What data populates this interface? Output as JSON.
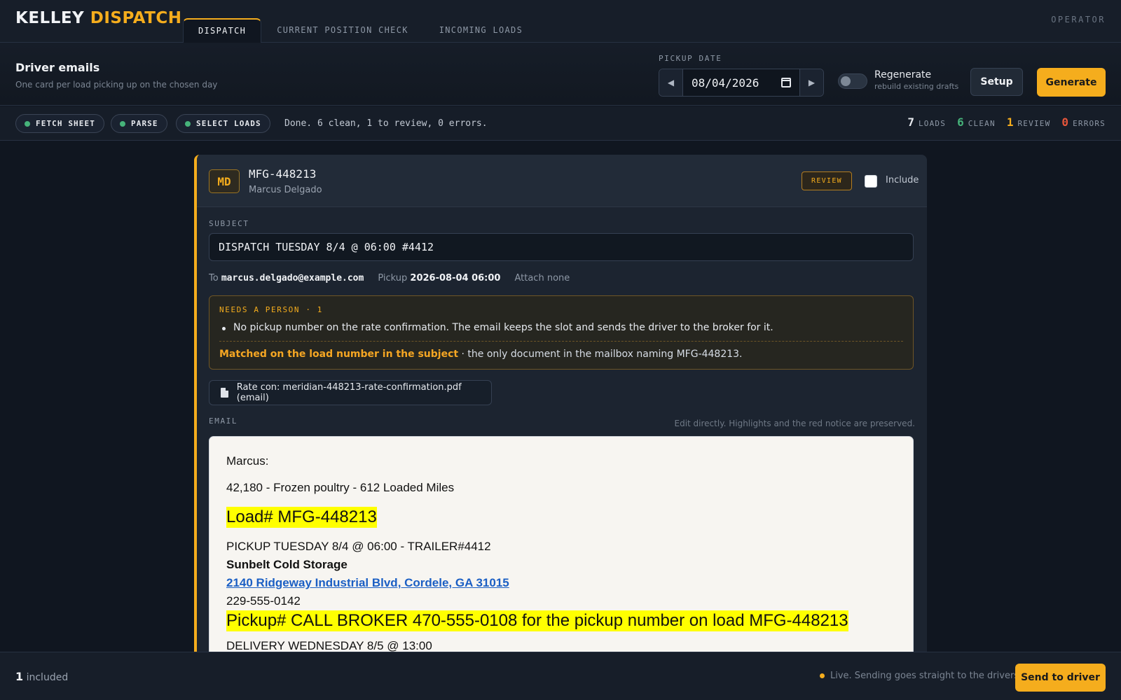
{
  "brand": {
    "part1": "KELLEY",
    "part2": "DISPATCH"
  },
  "tabs": [
    {
      "label": "DISPATCH",
      "active": true
    },
    {
      "label": "CURRENT POSITION CHECK",
      "active": false
    },
    {
      "label": "INCOMING LOADS",
      "active": false
    }
  ],
  "operator": "OPERATOR",
  "header": {
    "title": "Driver emails",
    "subtitle": "One card per load picking up on the chosen day",
    "pickup_label": "PICKUP DATE",
    "pickup_date": "08/04/2026",
    "regenerate_label": "Regenerate",
    "regenerate_sub": "rebuild existing drafts",
    "regenerate_on": false,
    "setup_label": "Setup",
    "generate_label": "Generate"
  },
  "status": {
    "steps": [
      "FETCH SHEET",
      "PARSE",
      "SELECT LOADS"
    ],
    "message": "Done. 6 clean, 1 to review, 0 errors.",
    "counts": [
      {
        "n": "7",
        "label": "LOADS",
        "color": "#e6e9ee"
      },
      {
        "n": "6",
        "label": "CLEAN",
        "color": "#46b37a"
      },
      {
        "n": "1",
        "label": "REVIEW",
        "color": "#f5ad1d"
      },
      {
        "n": "0",
        "label": "ERRORS",
        "color": "#e5553b"
      }
    ]
  },
  "card": {
    "initials": "MD",
    "load_id": "MFG-448213",
    "driver": "Marcus Delgado",
    "badge": "REVIEW",
    "include_label": "Include",
    "include_checked": false,
    "subject_label": "SUBJECT",
    "subject": "DISPATCH TUESDAY 8/4 @ 06:00 #4412",
    "meta": {
      "to_label": "To",
      "to": "marcus.delgado@example.com",
      "pickup_label": "Pickup",
      "pickup": "2026-08-04 06:00",
      "attach_label": "Attach",
      "attach": "none"
    },
    "alert": {
      "title": "NEEDS A PERSON · 1",
      "item": "No pickup number on the rate confirmation. The email keeps the slot and sends the driver to the broker for it.",
      "match_strong": "Matched on the load number in the subject",
      "match_rest": " · the only document in the mailbox naming MFG-448213."
    },
    "attachment": "Rate con: meridian-448213-rate-confirmation.pdf (email)",
    "email_label": "EMAIL",
    "edit_hint": "Edit directly. Highlights and the red notice are preserved.",
    "email": {
      "greeting": "Marcus:",
      "line1": "42,180 - Frozen poultry - 612 Loaded Miles",
      "load": "Load# MFG-448213",
      "pickup_line": "PICKUP TUESDAY 8/4 @ 06:00 - TRAILER#4412",
      "shipper": "Sunbelt Cold Storage",
      "address": "2140 Ridgeway Industrial Blvd, Cordele, GA 31015",
      "phone": "229-555-0142",
      "pickup_num": "Pickup# CALL BROKER 470-555-0108 for the pickup number on load MFG-448213",
      "delivery_line": "DELIVERY WEDNESDAY 8/5 @ 13:00"
    }
  },
  "footer": {
    "included_n": "1",
    "included_label": "included",
    "live_msg": "Live. Sending goes straight to the drivers.",
    "send_label": "Send to driver"
  }
}
